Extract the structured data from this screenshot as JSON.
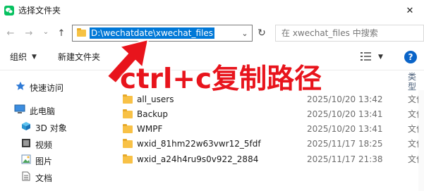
{
  "window": {
    "title": "选择文件夹",
    "icon": "wechat-icon",
    "close_glyph": "✕"
  },
  "nav": {
    "back_glyph": "←",
    "forward_glyph": "→",
    "recent_glyph": "⌄",
    "up_glyph": "↑"
  },
  "address": {
    "path": "D:\\wechatdate\\xwechat_files",
    "dropdown_glyph": "⌄",
    "refresh_glyph": "↻"
  },
  "search": {
    "placeholder": "在 xwechat_files 中搜索",
    "icon": "search-icon"
  },
  "toolbar": {
    "organize_label": "组织",
    "organize_caret": "▼",
    "new_folder_label": "新建文件夹",
    "view_caret": "▼",
    "help_label": "?"
  },
  "sidebar": {
    "items": [
      {
        "label": "快速访问",
        "icon": "quick-access-star-icon"
      },
      {
        "label": "此电脑",
        "icon": "this-pc-icon"
      },
      {
        "label": "3D 对象",
        "icon": "3d-objects-icon"
      },
      {
        "label": "视频",
        "icon": "videos-icon"
      },
      {
        "label": "图片",
        "icon": "pictures-icon"
      },
      {
        "label": "文档",
        "icon": "documents-icon"
      }
    ]
  },
  "file_list": {
    "type_header": "类型",
    "rows": [
      {
        "name": "all_users",
        "modified": "2025/10/20 13:42",
        "type": "文件"
      },
      {
        "name": "Backup",
        "modified": "2025/10/20 13:41",
        "type": "文件"
      },
      {
        "name": "WMPF",
        "modified": "2025/10/20 13:41",
        "type": "文件"
      },
      {
        "name": "wxid_81hm22w63vwr12_5fdf",
        "modified": "2025/11/17 18:25",
        "type": "文件"
      },
      {
        "name": "wxid_a24h4ru9s0v922_2884",
        "modified": "2025/11/17 21:38",
        "type": "文件"
      }
    ]
  },
  "annotation": {
    "text": "ctrl+c复制路径",
    "color": "#e8141c"
  },
  "colors": {
    "selection": "#0078d7",
    "folder": "#f8c146",
    "help": "#0a64c8",
    "wechat": "#07c160"
  }
}
